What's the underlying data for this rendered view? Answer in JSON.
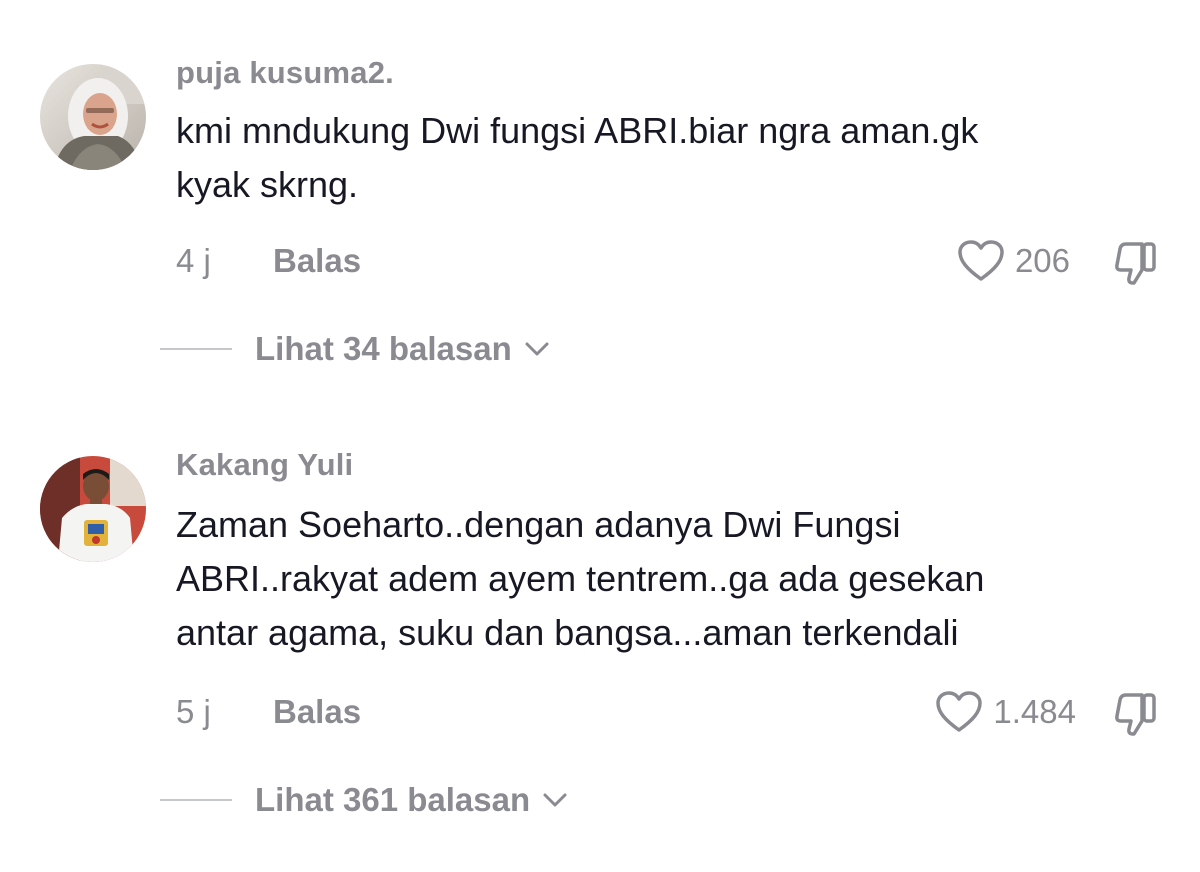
{
  "comments": [
    {
      "username": "puja kusuma2.",
      "text_lines": [
        "kmi mndukung Dwi fungsi ABRI.biar ngra aman.gk",
        "kyak skrng."
      ],
      "timestamp": "4 j",
      "reply_label": "Balas",
      "like_count": "206",
      "view_replies": "Lihat 34 balasan",
      "avatar_icon": "user-avatar-woman-hijab"
    },
    {
      "username": "Kakang Yuli",
      "text_lines": [
        "Zaman Soeharto..dengan adanya Dwi Fungsi",
        "ABRI..rakyat adem ayem tentrem..ga ada gesekan",
        "antar agama, suku dan bangsa...aman terkendali"
      ],
      "timestamp": "5 j",
      "reply_label": "Balas",
      "like_count": "1.484",
      "view_replies": "Lihat 361 balasan",
      "avatar_icon": "user-avatar-man"
    }
  ],
  "icons": {
    "like": "heart-icon",
    "dislike": "thumbs-down-icon",
    "expand": "chevron-down-icon"
  },
  "colors": {
    "text_primary": "#161823",
    "text_secondary": "#8a8b91",
    "divider": "#c6c7ca",
    "background": "#ffffff"
  }
}
